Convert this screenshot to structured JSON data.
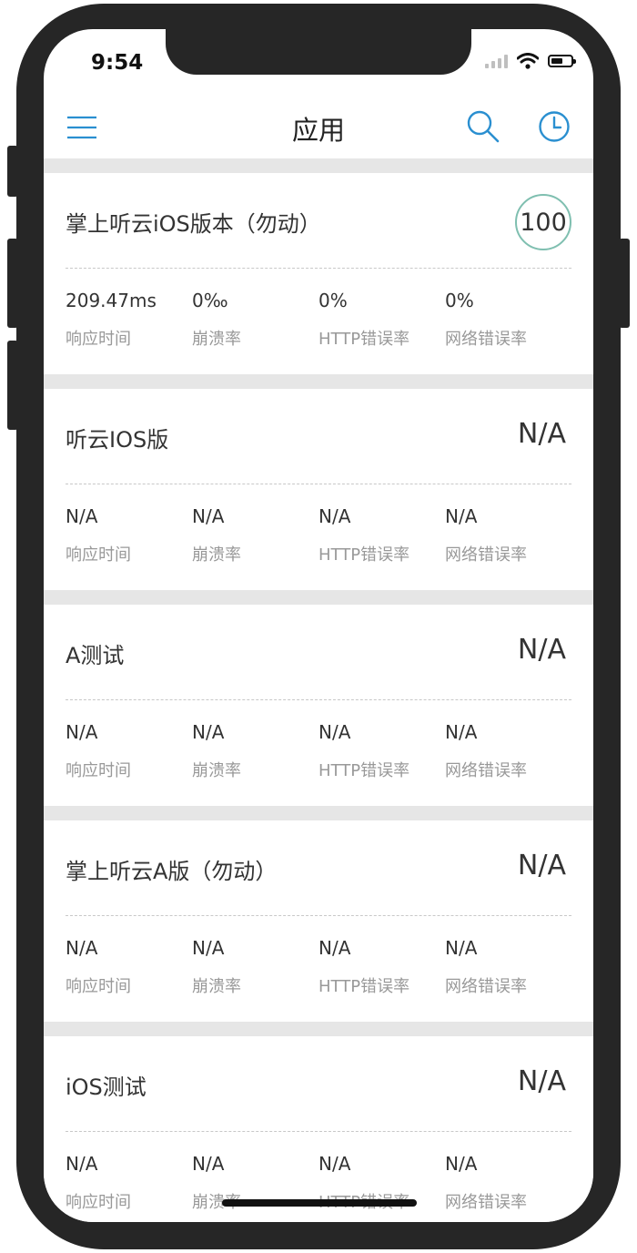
{
  "status": {
    "time": "9:54"
  },
  "navbar": {
    "title": "应用"
  },
  "metric_labels": [
    "响应时间",
    "崩溃率",
    "HTTP错误率",
    "网络错误率"
  ],
  "apps": [
    {
      "name": "掌上听云iOS版本（勿动）",
      "score": "100",
      "metrics": [
        "209.47ms",
        "0‰",
        "0%",
        "0%"
      ]
    },
    {
      "name": "听云IOS版",
      "score": "N/A",
      "metrics": [
        "N/A",
        "N/A",
        "N/A",
        "N/A"
      ]
    },
    {
      "name": "A测试",
      "score": "N/A",
      "metrics": [
        "N/A",
        "N/A",
        "N/A",
        "N/A"
      ]
    },
    {
      "name": "掌上听云A版（勿动）",
      "score": "N/A",
      "metrics": [
        "N/A",
        "N/A",
        "N/A",
        "N/A"
      ]
    },
    {
      "name": "iOS测试",
      "score": "N/A",
      "metrics": [
        "N/A",
        "N/A",
        "N/A",
        "N/A"
      ]
    }
  ],
  "colors": {
    "accent": "#2a8fd0",
    "score_ring": "#7fbfb0",
    "separator": "#e6e6e6"
  },
  "icons": [
    "menu-icon",
    "search-icon",
    "clock-icon",
    "signal-icon",
    "wifi-icon",
    "battery-icon"
  ]
}
